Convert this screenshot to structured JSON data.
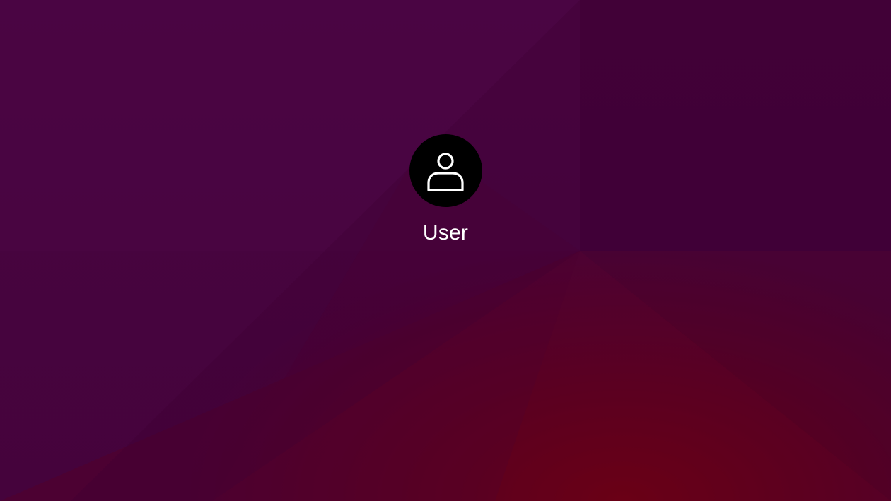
{
  "login": {
    "username": "User",
    "avatar_icon": "person-icon"
  },
  "colors": {
    "background_top": "#4a0542",
    "background_accent": "#76000e",
    "avatar_bg": "#000000",
    "text": "#ffffff"
  }
}
